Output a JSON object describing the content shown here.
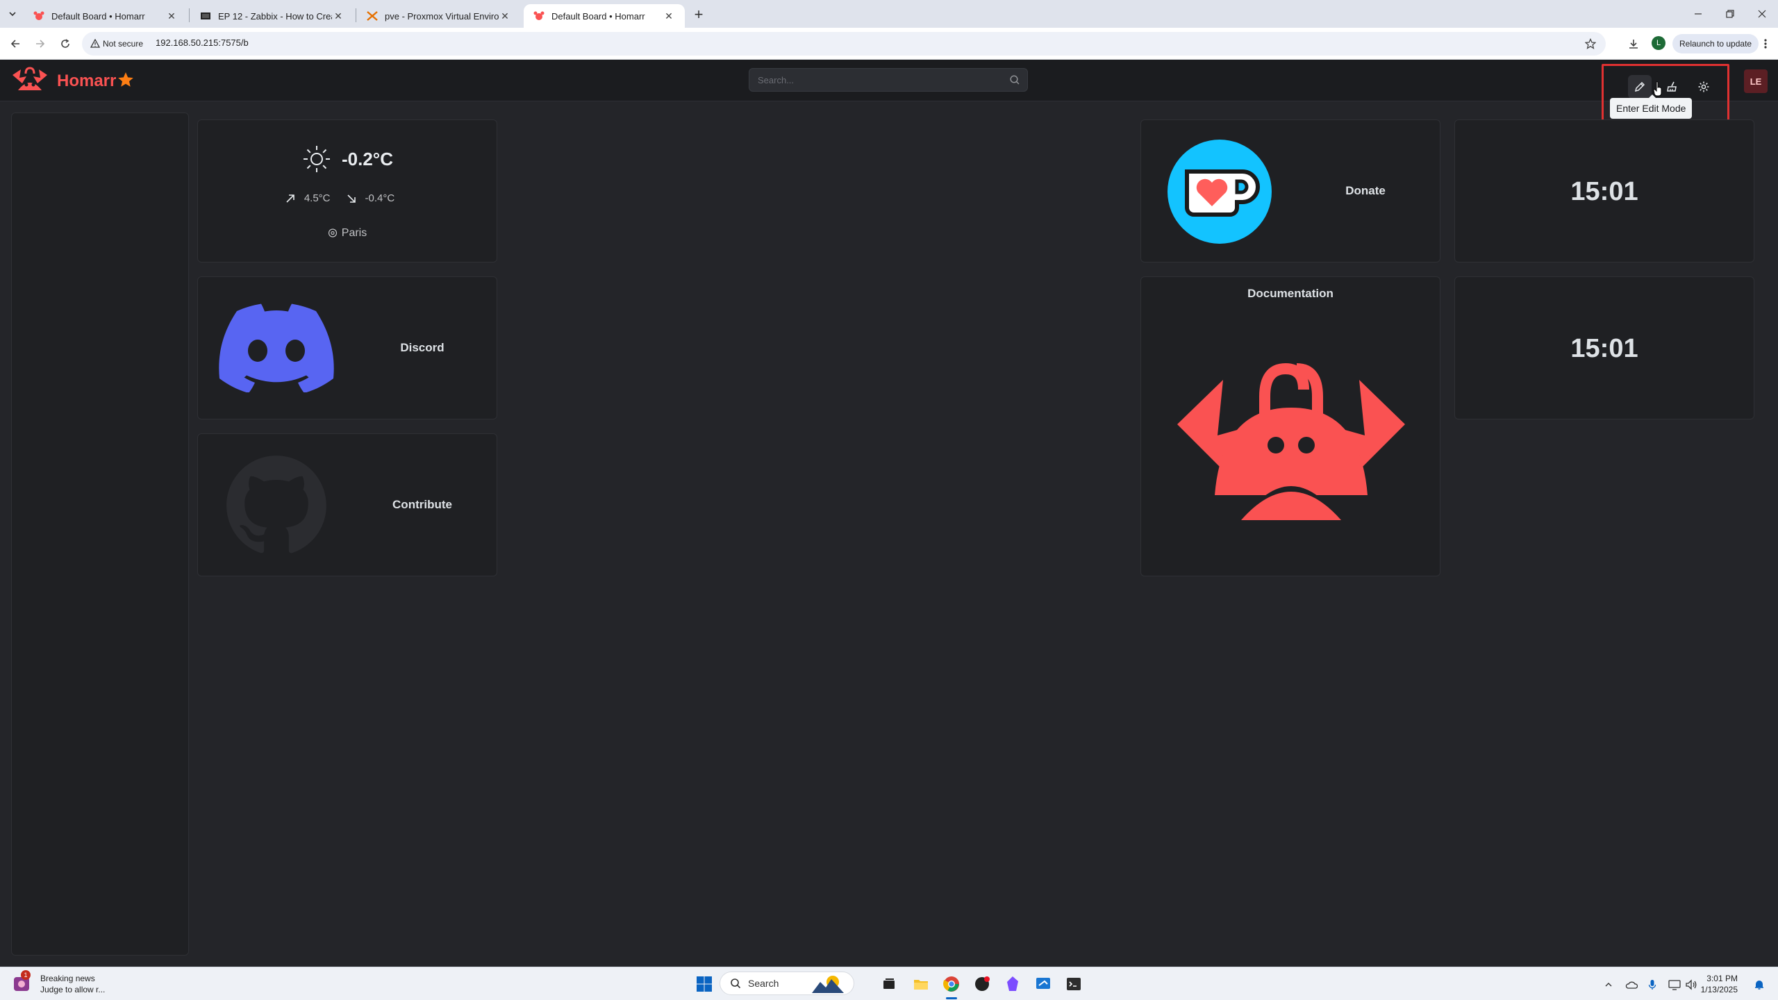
{
  "browser": {
    "tabs": [
      {
        "title": "Default Board • Homarr",
        "active": false
      },
      {
        "title": "EP 12 - Zabbix - How to Create",
        "active": false
      },
      {
        "title": "pve - Proxmox Virtual Environm",
        "active": false
      },
      {
        "title": "Default Board • Homarr",
        "active": true
      }
    ],
    "security_label": "Not secure",
    "url": "192.168.50.215:7575/b",
    "profile_initial": "L",
    "relaunch_label": "Relaunch to update"
  },
  "app": {
    "title": "Homarr",
    "brand_color": "#fa5252",
    "search_placeholder": "Search...",
    "tooltip": "Enter Edit Mode",
    "avatar": "LE"
  },
  "weather": {
    "current": "-0.2°C",
    "max": "4.5°C",
    "min": "-0.4°C",
    "location": "Paris",
    "icon": "sun-icon"
  },
  "apps": {
    "discord": "Discord",
    "contribute": "Contribute",
    "donate": "Donate",
    "documentation": "Documentation"
  },
  "clocks": [
    "15:01",
    "15:01"
  ],
  "taskbar": {
    "news_title": "Breaking news",
    "news_sub": "Judge to allow r...",
    "news_badge": "1",
    "search_label": "Search",
    "time": "3:01 PM",
    "date": "1/13/2025"
  }
}
